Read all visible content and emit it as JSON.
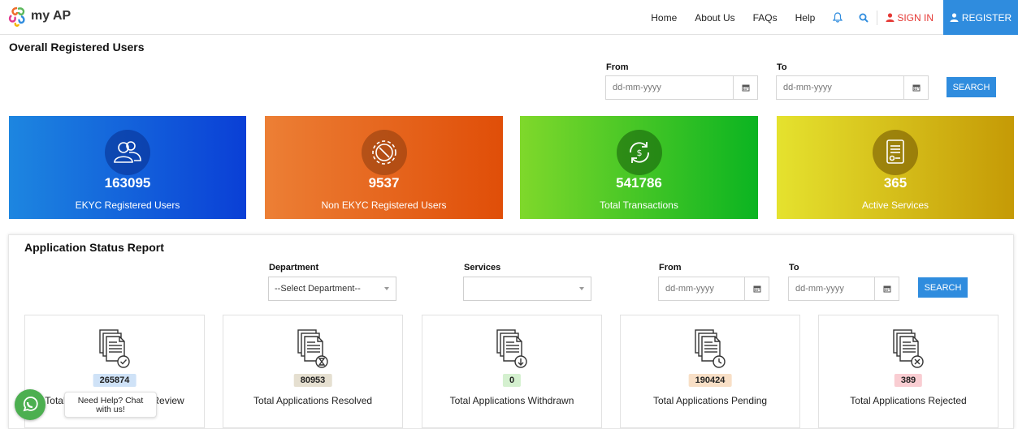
{
  "header": {
    "brand": "my AP",
    "nav": [
      "Home",
      "About Us",
      "FAQs",
      "Help"
    ],
    "sign_in": "SIGN IN",
    "register": "REGISTER"
  },
  "overall": {
    "title": "Overall Registered Users",
    "from_label": "From",
    "to_label": "To",
    "date_placeholder": "dd-mm-yyyy",
    "search": "SEARCH",
    "cards": [
      {
        "value": "163095",
        "label": "EKYC Registered Users",
        "icon": "users-icon",
        "gradient": [
          "#1d86e0",
          "#0a3fd6"
        ]
      },
      {
        "value": "9537",
        "label": "Non EKYC Registered Users",
        "icon": "gear-cancel-icon",
        "gradient": [
          "#ec7f35",
          "#e04e08"
        ]
      },
      {
        "value": "541786",
        "label": "Total Transactions",
        "icon": "transactions-icon",
        "gradient": [
          "#7fd82b",
          "#0bb421"
        ]
      },
      {
        "value": "365",
        "label": "Active Services",
        "icon": "document-icon",
        "gradient": [
          "#e5e22e",
          "#c59a06"
        ]
      }
    ]
  },
  "status": {
    "title": "Application Status Report",
    "department_label": "Department",
    "department_value": "--Select Department--",
    "services_label": "Services",
    "from_label": "From",
    "to_label": "To",
    "date_placeholder": "dd-mm-yyyy",
    "search": "SEARCH",
    "cards": [
      {
        "value": "265874",
        "label": "Total Applications Under Review",
        "badge_color": "#cfe2f7",
        "icon": "doc-check-icon"
      },
      {
        "value": "80953",
        "label": "Total Applications Resolved",
        "badge_color": "#e5dfd0",
        "icon": "doc-hourglass-icon"
      },
      {
        "value": "0",
        "label": "Total Applications Withdrawn",
        "badge_color": "#d4f0cf",
        "icon": "doc-download-icon"
      },
      {
        "value": "190424",
        "label": "Total Applications Pending",
        "badge_color": "#f8dfc6",
        "icon": "doc-clock-icon"
      },
      {
        "value": "389",
        "label": "Total Applications Rejected",
        "badge_color": "#f9cdd2",
        "icon": "doc-cancel-icon"
      }
    ]
  },
  "help": {
    "line1": "Need Help? Chat",
    "line2": "with us!"
  },
  "colors": {
    "accent": "#2f8cde",
    "signin": "#e53935",
    "whatsapp": "#4caf50"
  }
}
